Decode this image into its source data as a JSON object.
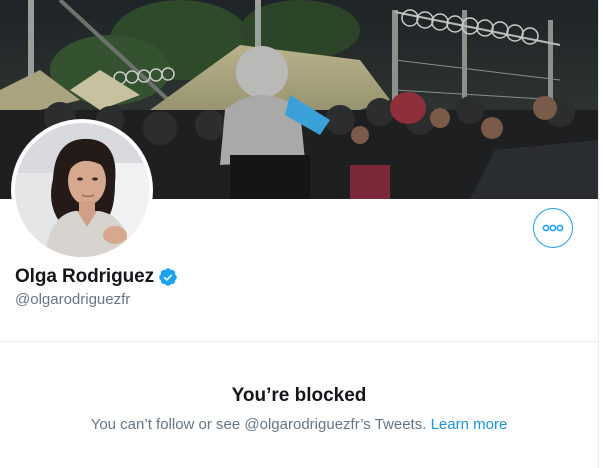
{
  "profile": {
    "display_name": "Olga Rodriguez",
    "verified": true,
    "handle": "@olgarodriguezfr"
  },
  "blocked": {
    "title": "You’re blocked",
    "message_prefix": "You can’t follow or see @olgarodriguezfr’s Tweets.",
    "learn_more_label": "Learn more"
  },
  "icons": {
    "more": "more-horizontal-icon",
    "verified": "verified-badge-icon"
  },
  "colors": {
    "accent": "#1da1f2",
    "link": "#1b95e0",
    "secondary_text": "#657786",
    "primary_text": "#14171a",
    "divider": "#e6ecf0"
  }
}
